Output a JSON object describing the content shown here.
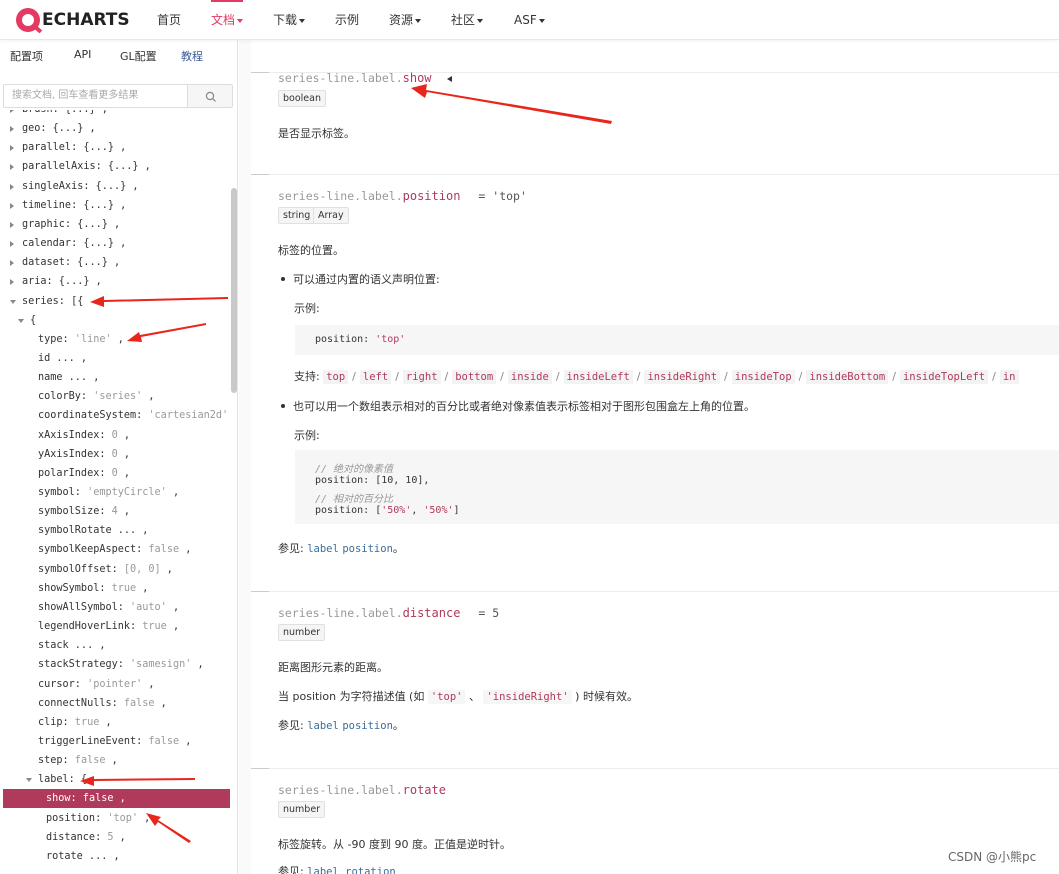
{
  "nav": {
    "logo_text": "ECHARTS",
    "items": [
      {
        "label": "首页",
        "caret": false,
        "active": false
      },
      {
        "label": "文档",
        "caret": true,
        "active": true
      },
      {
        "label": "下载",
        "caret": true,
        "active": false
      },
      {
        "label": "示例",
        "caret": false,
        "active": false
      },
      {
        "label": "资源",
        "caret": true,
        "active": false
      },
      {
        "label": "社区",
        "caret": true,
        "active": false
      },
      {
        "label": "ASF",
        "caret": true,
        "active": false
      }
    ]
  },
  "sidebar": {
    "tabs": [
      "配置项",
      "API",
      "GL配置",
      "教程"
    ],
    "search_placeholder": "搜索文档, 回车查看更多结果",
    "tree": [
      {
        "key": "brush: {...} ,",
        "val": ""
      },
      {
        "key": "geo: {...} ,",
        "val": ""
      },
      {
        "key": "parallel: {...} ,",
        "val": ""
      },
      {
        "key": "parallelAxis: {...} ,",
        "val": ""
      },
      {
        "key": "singleAxis: {...} ,",
        "val": ""
      },
      {
        "key": "timeline: {...} ,",
        "val": ""
      },
      {
        "key": "graphic: {...} ,",
        "val": ""
      },
      {
        "key": "calendar: {...} ,",
        "val": ""
      },
      {
        "key": "dataset: {...} ,",
        "val": ""
      },
      {
        "key": "aria: {...} ,",
        "val": ""
      },
      {
        "key": "series: [{",
        "val": ""
      },
      {
        "key": "{",
        "val": ""
      },
      {
        "key": "type:",
        "val": "'line'",
        "end": " ,"
      },
      {
        "key": "id ... ,",
        "val": ""
      },
      {
        "key": "name ... ,",
        "val": ""
      },
      {
        "key": "colorBy:",
        "val": "'series'",
        "end": " ,"
      },
      {
        "key": "coordinateSystem:",
        "val": "'cartesian2d'",
        "end": ""
      },
      {
        "key": "xAxisIndex:",
        "val": "0",
        "end": " ,"
      },
      {
        "key": "yAxisIndex:",
        "val": "0",
        "end": " ,"
      },
      {
        "key": "polarIndex:",
        "val": "0",
        "end": " ,"
      },
      {
        "key": "symbol:",
        "val": "'emptyCircle'",
        "end": " ,"
      },
      {
        "key": "symbolSize:",
        "val": "4",
        "end": " ,"
      },
      {
        "key": "symbolRotate ... ,",
        "val": ""
      },
      {
        "key": "symbolKeepAspect:",
        "val": "false",
        "end": " ,"
      },
      {
        "key": "symbolOffset:",
        "val": "[0, 0]",
        "end": " ,"
      },
      {
        "key": "showSymbol:",
        "val": "true",
        "end": " ,"
      },
      {
        "key": "showAllSymbol:",
        "val": "'auto'",
        "end": " ,"
      },
      {
        "key": "legendHoverLink:",
        "val": "true",
        "end": " ,"
      },
      {
        "key": "stack ... ,",
        "val": ""
      },
      {
        "key": "stackStrategy:",
        "val": "'samesign'",
        "end": " ,"
      },
      {
        "key": "cursor:",
        "val": "'pointer'",
        "end": " ,"
      },
      {
        "key": "connectNulls:",
        "val": "false",
        "end": " ,"
      },
      {
        "key": "clip:",
        "val": "true",
        "end": " ,"
      },
      {
        "key": "triggerLineEvent:",
        "val": "false",
        "end": " ,"
      },
      {
        "key": "step:",
        "val": "false",
        "end": " ,"
      },
      {
        "key": "label: {",
        "val": ""
      },
      {
        "key": "show:",
        "val": "false",
        "end": " ,"
      },
      {
        "key": "position:",
        "val": "'top'",
        "end": " ,"
      },
      {
        "key": "distance:",
        "val": "5",
        "end": " ,"
      },
      {
        "key": "rotate ... ,",
        "val": ""
      }
    ]
  },
  "main": {
    "prefix": "series-line.label.",
    "show": {
      "name": "show",
      "type": "boolean",
      "desc": "是否显示标签。"
    },
    "position": {
      "name": "position",
      "default": "= 'top'",
      "types": [
        "string",
        "Array"
      ],
      "desc": "标签的位置。",
      "bullet1": "可以通过内置的语义声明位置:",
      "example_label": "示例:",
      "code1": "position: ",
      "code1_val": "'top'",
      "support_label": "支持:",
      "support_options": [
        "top",
        "left",
        "right",
        "bottom",
        "inside",
        "insideLeft",
        "insideRight",
        "insideTop",
        "insideBottom",
        "insideTopLeft",
        "in"
      ],
      "bullet2": "也可以用一个数组表示相对的百分比或者绝对像素值表示标签相对于图形包围盒左上角的位置。",
      "example_label2": "示例:",
      "code2": {
        "c1": "// 绝对的像素值",
        "l1": "position: [10, 10],",
        "c2": "// 相对的百分比",
        "l2a": "position: [",
        "l2b": "'50%'",
        "l2c": ", ",
        "l2d": "'50%'",
        "l2e": "]"
      },
      "see_label": "参见:",
      "see_links": [
        "label",
        "position"
      ],
      "see_end": "。"
    },
    "distance": {
      "name": "distance",
      "default": "= 5",
      "type": "number",
      "desc": "距离图形元素的距离。",
      "note_a": "当 position 为字符描述值 (如 ",
      "note_code1": "'top'",
      "note_b": " 、 ",
      "note_code2": "'insideRight'",
      "note_c": " ) 时候有效。",
      "see_label": "参见:",
      "see_links": [
        "label",
        "position"
      ],
      "see_end": "。"
    },
    "rotate": {
      "name": "rotate",
      "type": "number",
      "desc": "标签旋转。从 -90 度到 90 度。正值是逆时针。",
      "see_label": "参见:",
      "see_link": "label rotation"
    }
  },
  "watermark": "CSDN @小熊pc",
  "colors": {
    "accent": "#e43961",
    "selected_row": "#b03a5b",
    "link": "#3c6e99",
    "arrow": "#e8261c"
  }
}
